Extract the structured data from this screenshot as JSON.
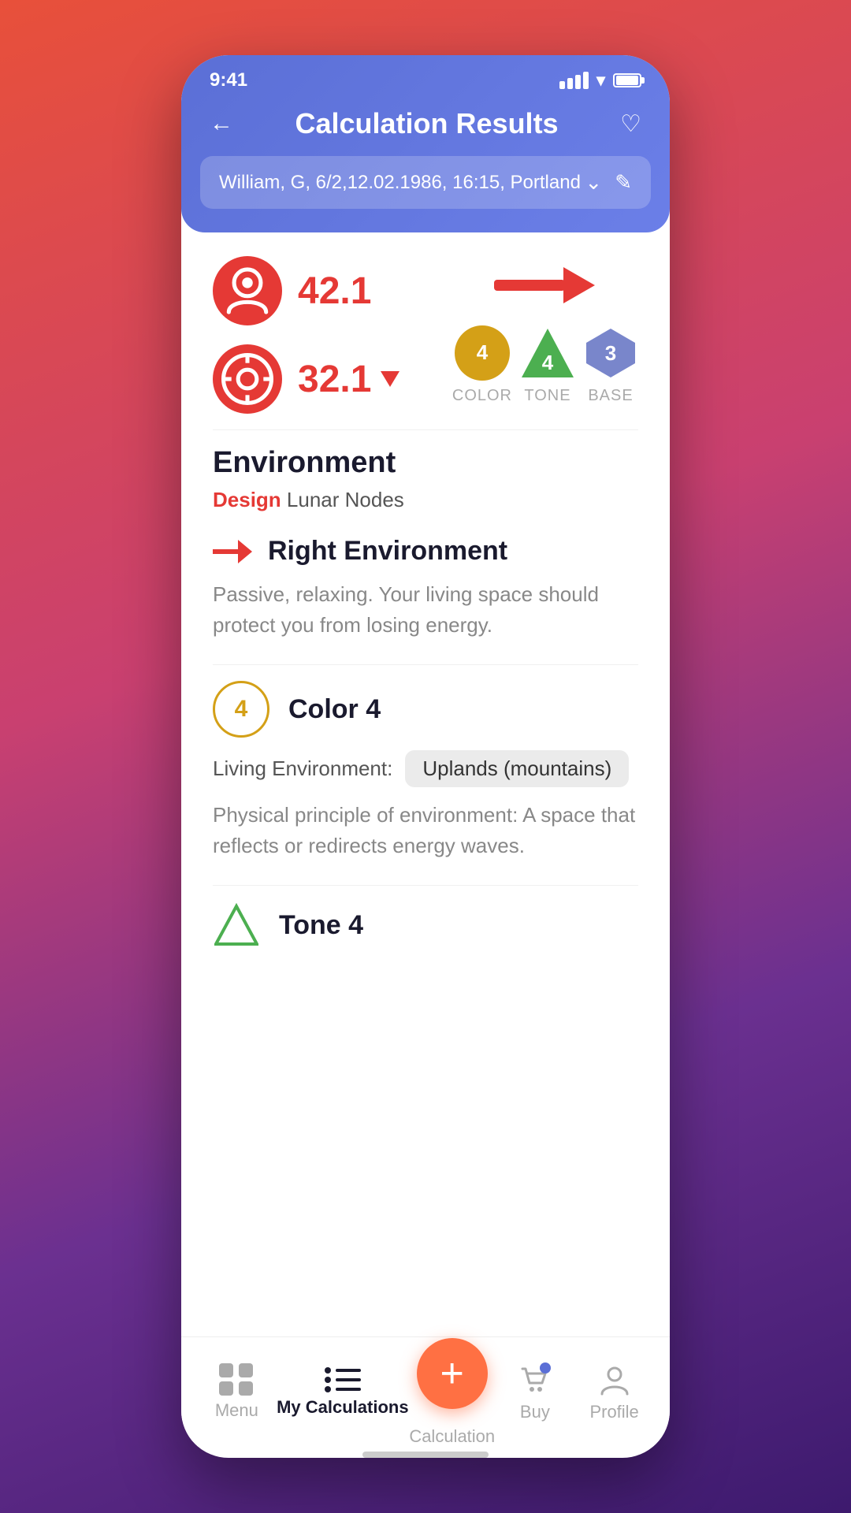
{
  "statusBar": {
    "time": "9:41"
  },
  "header": {
    "title": "Calculation Results",
    "backLabel": "←",
    "favoriteLabel": "♡",
    "personInfo": "William, G, 6/2,12.02.1986, 16:15, Portland",
    "dropdownIcon": "chevron-down",
    "editIcon": "edit"
  },
  "scores": {
    "score1": "42.1",
    "score2": "32.1"
  },
  "badges": {
    "color": {
      "value": "4",
      "label": "COLOR"
    },
    "tone": {
      "value": "4",
      "label": "TONE"
    },
    "base": {
      "value": "3",
      "label": "BASE"
    }
  },
  "environment": {
    "sectionTitle": "Environment",
    "subtitle_highlight": "Design",
    "subtitle_rest": " Lunar Nodes",
    "result_label": "Right Environment",
    "description": "Passive, relaxing. Your living space should protect you from losing energy.",
    "color_section": {
      "badge": "4",
      "title": "Color 4",
      "living_label": "Living Environment:",
      "living_value": "Uplands (mountains)",
      "physical_desc": "Physical principle of environment: A space that reflects or redirects energy waves."
    },
    "tone_section": {
      "title": "Tone 4"
    }
  },
  "bottomNav": {
    "items": [
      {
        "id": "menu",
        "label": "Menu",
        "icon": "⊞",
        "active": false
      },
      {
        "id": "my-calculations",
        "label": "My Calculations",
        "icon": "≡",
        "active": true
      },
      {
        "id": "calculation",
        "label": "Calculation",
        "icon": "+",
        "fab": true
      },
      {
        "id": "buy",
        "label": "Buy",
        "icon": "🛒",
        "active": false
      },
      {
        "id": "profile",
        "label": "Profile",
        "icon": "👤",
        "active": false
      }
    ]
  },
  "colors": {
    "accent": "#e53935",
    "purple": "#5b6fd6",
    "gold": "#d4a017",
    "green": "#4caf50",
    "slate": "#7986cb",
    "fab": "#ff7043"
  }
}
